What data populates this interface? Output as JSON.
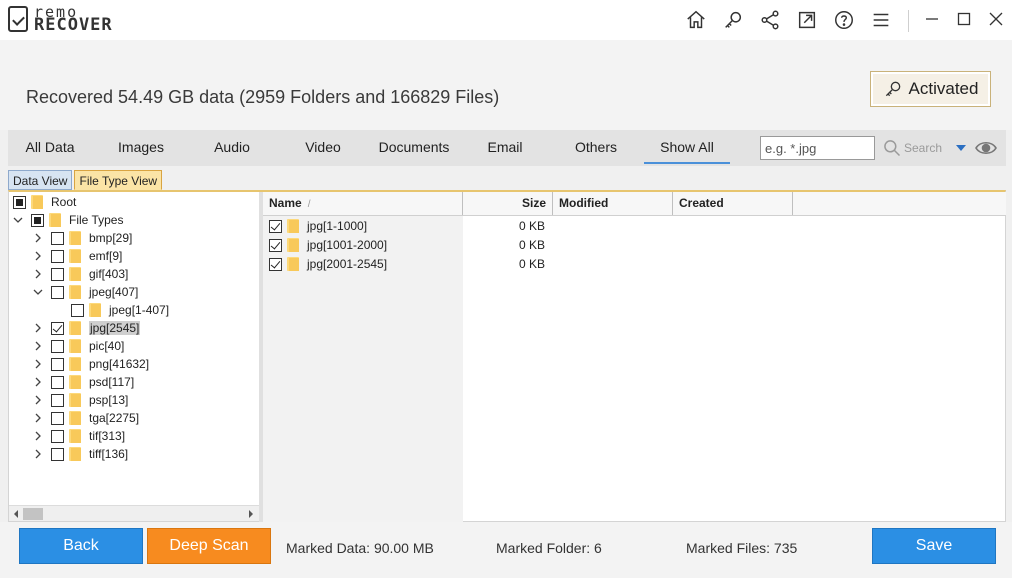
{
  "app": {
    "logo_top": "remo",
    "logo_bottom": "RECOVER"
  },
  "titlebar": {
    "icons": [
      "home-icon",
      "key-icon",
      "share-icon",
      "export-icon",
      "help-icon",
      "menu-icon"
    ],
    "window_buttons": [
      "minimize-icon",
      "maximize-icon",
      "close-icon"
    ]
  },
  "header": {
    "recovered_text": "Recovered 54.49 GB data (2959 Folders and 166829 Files)",
    "activated_label": "Activated"
  },
  "tabs": [
    {
      "label": "All Data"
    },
    {
      "label": "Images"
    },
    {
      "label": "Audio"
    },
    {
      "label": "Video"
    },
    {
      "label": "Documents"
    },
    {
      "label": "Email"
    },
    {
      "label": "Others"
    },
    {
      "label": "Show All",
      "active": true
    }
  ],
  "search": {
    "placeholder": "e.g. *.jpg",
    "button_label": "Search"
  },
  "view_tabs": [
    {
      "label": "Data View"
    },
    {
      "label": "File Type View",
      "active": true
    }
  ],
  "tree": [
    {
      "label": "Root",
      "check": "partial"
    },
    {
      "label": "File Types",
      "check": "partial",
      "expanded": true
    },
    {
      "label": "bmp[29]"
    },
    {
      "label": "emf[9]"
    },
    {
      "label": "gif[403]"
    },
    {
      "label": "jpeg[407]",
      "expanded": true
    },
    {
      "label": "jpeg[1-407]"
    },
    {
      "label": "jpg[2545]",
      "check": "checked",
      "selected": true
    },
    {
      "label": "pic[40]"
    },
    {
      "label": "png[41632]"
    },
    {
      "label": "psd[117]"
    },
    {
      "label": "psp[13]"
    },
    {
      "label": "tga[2275]"
    },
    {
      "label": "tif[313]"
    },
    {
      "label": "tiff[136]"
    }
  ],
  "grid": {
    "columns": {
      "name": "Name",
      "size": "Size",
      "modified": "Modified",
      "created": "Created"
    },
    "rows": [
      {
        "name": "jpg[1-1000]",
        "size": "0 KB"
      },
      {
        "name": "jpg[1001-2000]",
        "size": "0 KB"
      },
      {
        "name": "jpg[2001-2545]",
        "size": "0 KB"
      }
    ]
  },
  "footer": {
    "back_label": "Back",
    "deep_scan_label": "Deep Scan",
    "save_label": "Save",
    "marked_data_label": "Marked Data:",
    "marked_data_value": "90.00 MB",
    "marked_folder_label": "Marked Folder:",
    "marked_folder_value": "6",
    "marked_files_label": "Marked Files:",
    "marked_files_value": "735"
  },
  "colors": {
    "accent_blue": "#2b8fe4",
    "accent_orange": "#f78b1f",
    "tab_underline": "#4a90d9"
  }
}
